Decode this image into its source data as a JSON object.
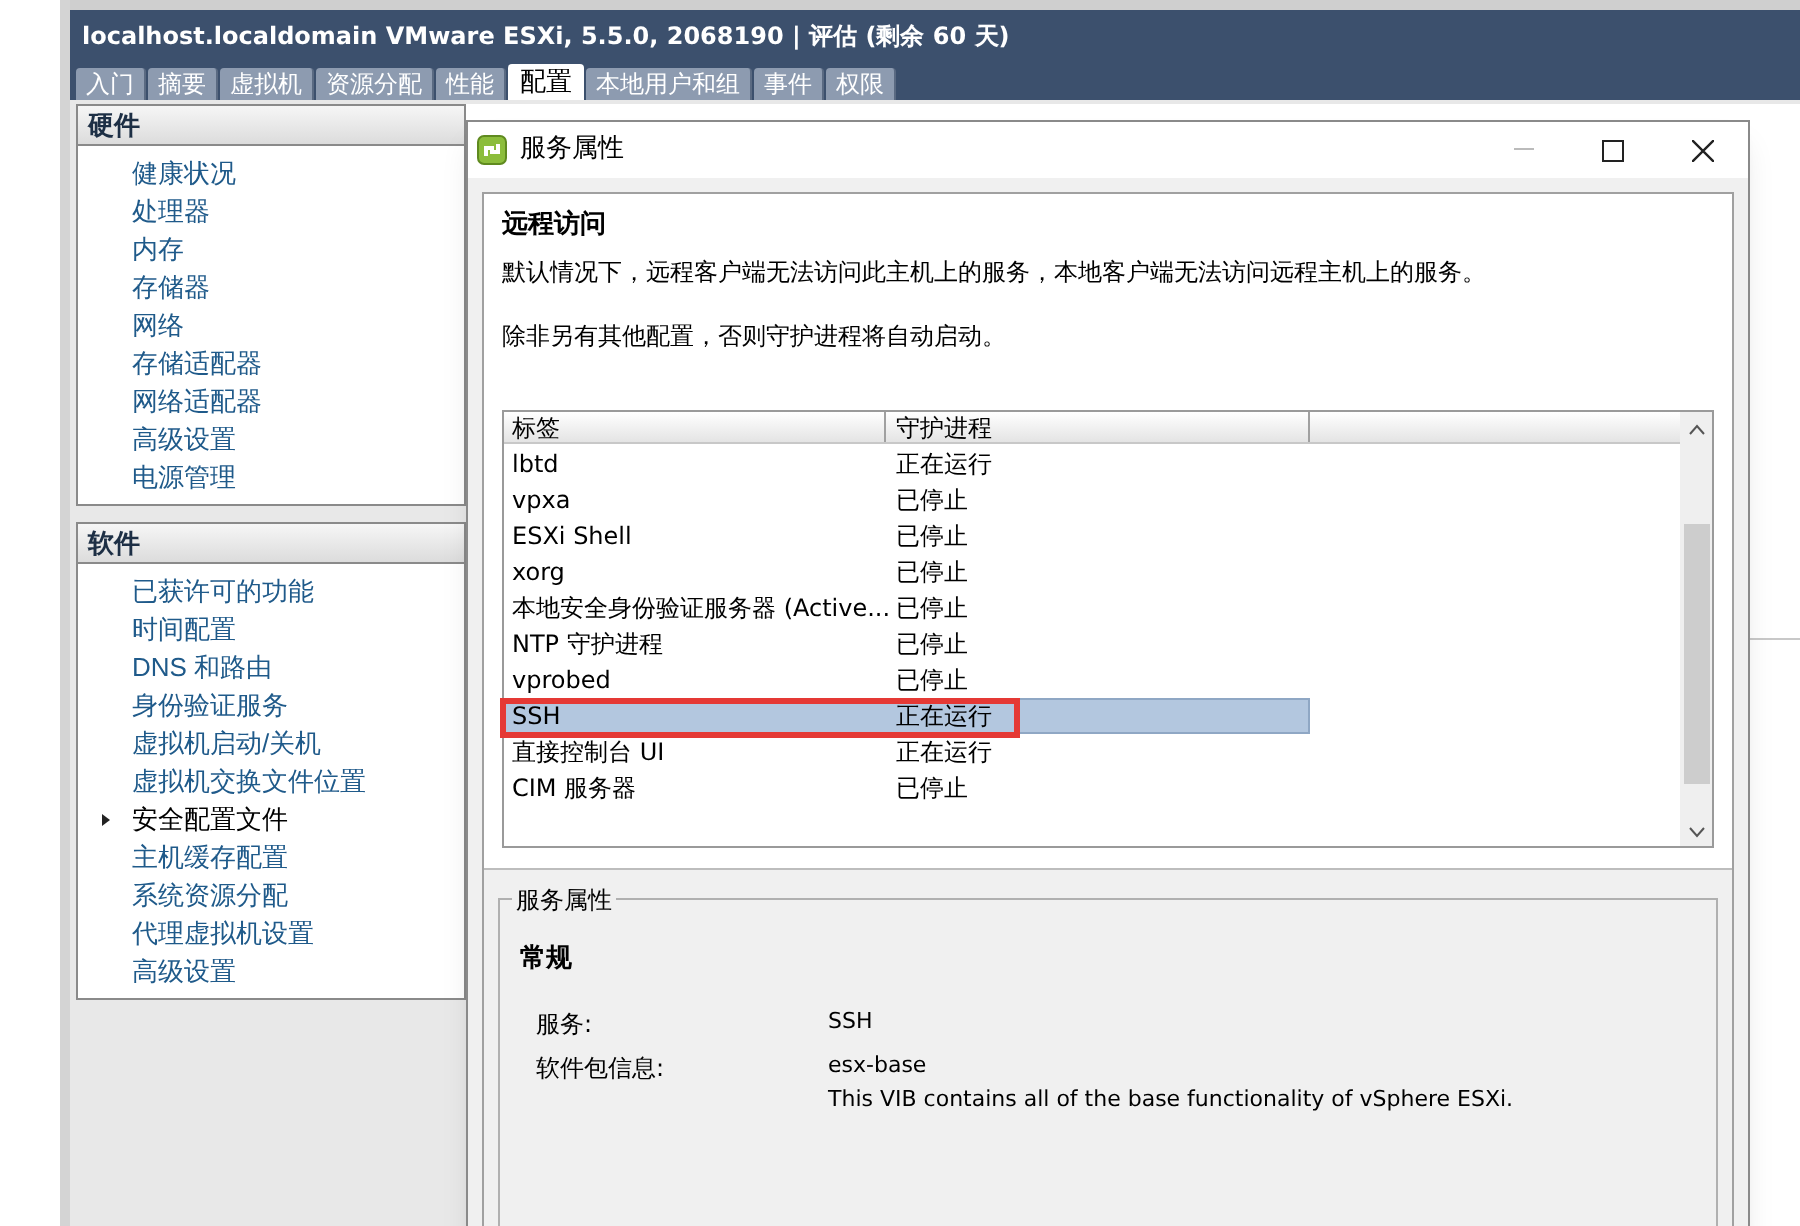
{
  "window": {
    "title": "localhost.localdomain VMware ESXi, 5.5.0, 2068190 | 评估 (剩余 60 天)"
  },
  "tabs": [
    {
      "label": "入门",
      "selected": false
    },
    {
      "label": "摘要",
      "selected": false
    },
    {
      "label": "虚拟机",
      "selected": false
    },
    {
      "label": "资源分配",
      "selected": false
    },
    {
      "label": "性能",
      "selected": false
    },
    {
      "label": "配置",
      "selected": true
    },
    {
      "label": "本地用户和组",
      "selected": false
    },
    {
      "label": "事件",
      "selected": false
    },
    {
      "label": "权限",
      "selected": false
    }
  ],
  "sidebar": {
    "sections": [
      {
        "title": "硬件",
        "items": [
          {
            "label": "健康状况",
            "selected": false
          },
          {
            "label": "处理器",
            "selected": false
          },
          {
            "label": "内存",
            "selected": false
          },
          {
            "label": "存储器",
            "selected": false
          },
          {
            "label": "网络",
            "selected": false
          },
          {
            "label": "存储适配器",
            "selected": false
          },
          {
            "label": "网络适配器",
            "selected": false
          },
          {
            "label": "高级设置",
            "selected": false
          },
          {
            "label": "电源管理",
            "selected": false
          }
        ]
      },
      {
        "title": "软件",
        "items": [
          {
            "label": "已获许可的功能",
            "selected": false
          },
          {
            "label": "时间配置",
            "selected": false
          },
          {
            "label": "DNS 和路由",
            "selected": false
          },
          {
            "label": "身份验证服务",
            "selected": false
          },
          {
            "label": "虚拟机启动/关机",
            "selected": false
          },
          {
            "label": "虚拟机交换文件位置",
            "selected": false
          },
          {
            "label": "安全配置文件",
            "selected": true
          },
          {
            "label": "主机缓存配置",
            "selected": false
          },
          {
            "label": "系统资源分配",
            "selected": false
          },
          {
            "label": "代理虚拟机设置",
            "selected": false
          },
          {
            "label": "高级设置",
            "selected": false
          }
        ]
      }
    ]
  },
  "dialog": {
    "title": "服务属性",
    "remote_access": {
      "heading": "远程访问",
      "description": "默认情况下，远程客户端无法访问此主机上的服务，本地客户端无法访问远程主机上的服务。",
      "note": "除非另有其他配置，否则守护进程将自动启动。"
    },
    "table": {
      "columns": [
        "标签",
        "守护进程"
      ],
      "rows": [
        {
          "label": "lbtd",
          "daemon": "正在运行",
          "selected": false,
          "highlighted": false
        },
        {
          "label": "vpxa",
          "daemon": "已停止",
          "selected": false,
          "highlighted": false
        },
        {
          "label": "ESXi Shell",
          "daemon": "已停止",
          "selected": false,
          "highlighted": false
        },
        {
          "label": "xorg",
          "daemon": "已停止",
          "selected": false,
          "highlighted": false
        },
        {
          "label": "本地安全身份验证服务器 (Active...",
          "daemon": "已停止",
          "selected": false,
          "highlighted": false
        },
        {
          "label": "NTP 守护进程",
          "daemon": "已停止",
          "selected": false,
          "highlighted": false
        },
        {
          "label": "vprobed",
          "daemon": "已停止",
          "selected": false,
          "highlighted": false
        },
        {
          "label": "SSH",
          "daemon": "正在运行",
          "selected": true,
          "highlighted": true
        },
        {
          "label": "直接控制台 UI",
          "daemon": "正在运行",
          "selected": false,
          "highlighted": false
        },
        {
          "label": "CIM 服务器",
          "daemon": "已停止",
          "selected": false,
          "highlighted": false
        }
      ]
    },
    "properties": {
      "group_title": "服务属性",
      "section": "常规",
      "fields": [
        {
          "label": "服务:",
          "value": "SSH"
        },
        {
          "label": "软件包信息:",
          "value": "esx-base",
          "detail": "This VIB contains all of the base functionality of vSphere ESXi."
        }
      ]
    }
  }
}
